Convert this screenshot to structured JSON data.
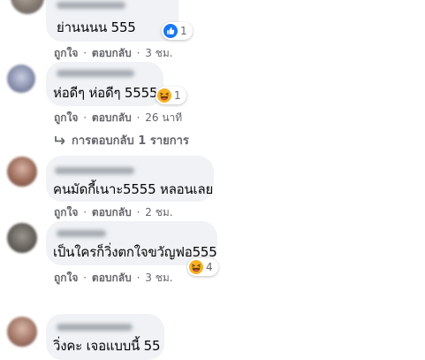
{
  "comments": [
    {
      "text": "ย่านนนน 555",
      "reaction": {
        "icon": "like-icon",
        "count": "1"
      },
      "actions": {
        "like": "ถูกใจ",
        "reply": "ตอบกลับ",
        "time": "3 ชม."
      }
    },
    {
      "text": "ห่อดีๆ ห่อดีๆ 5555",
      "reaction": {
        "icon": "haha-icon",
        "count": "1"
      },
      "actions": {
        "like": "ถูกใจ",
        "reply": "ตอบกลับ",
        "time": "26 นาที"
      },
      "replies": "การตอบกลับ 1 รายการ"
    },
    {
      "text": "คนมัดกี้เนาะ5555 หลอนเลย",
      "actions": {
        "like": "ถูกใจ",
        "reply": "ตอบกลับ",
        "time": "2 ชม."
      }
    },
    {
      "text": "เป็นใครก็วิ่งตกใจขวัญฟอ555",
      "reaction": {
        "icon": "haha-icon",
        "count": "4"
      },
      "actions": {
        "like": "ถูกใจ",
        "reply": "ตอบกลับ",
        "time": "3 ชม."
      }
    },
    {
      "text": "วิ่งคะ เจอแบบนี้ 55"
    }
  ],
  "separator": "·",
  "colors": {
    "bubble": "#f0f2f5",
    "meta": "#65676b",
    "like_blue": "#1877f2",
    "haha_yellow": "#f7b125"
  }
}
